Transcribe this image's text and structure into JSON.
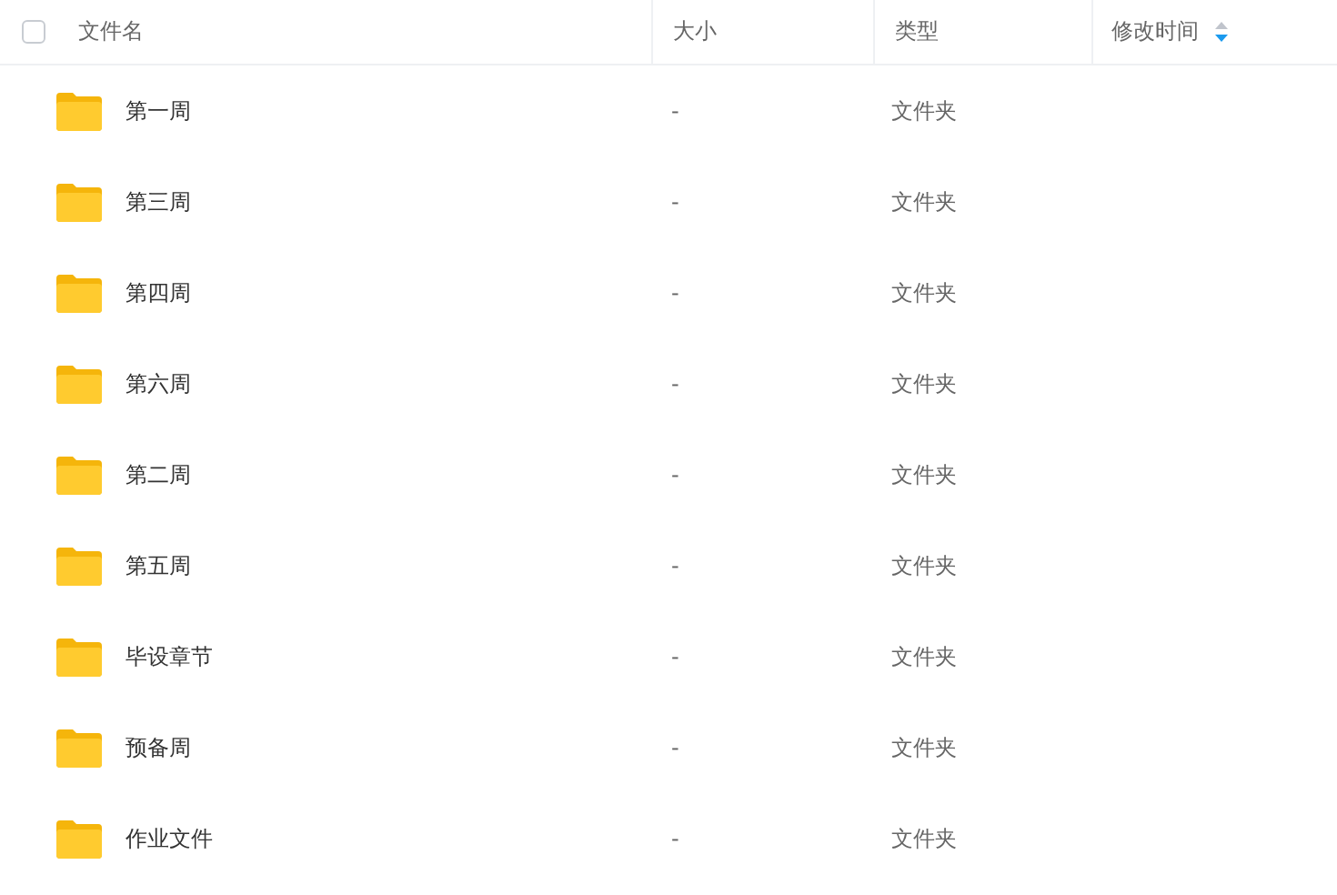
{
  "table": {
    "select_all": {
      "checked": false
    },
    "columns": [
      {
        "label": "文件名"
      },
      {
        "label": "大小"
      },
      {
        "label": "类型"
      },
      {
        "label": "修改时间",
        "sorted_descending": true
      }
    ],
    "rows": [
      {
        "name": "第一周",
        "size": "-",
        "type": "文件夹"
      },
      {
        "name": "第三周",
        "size": "-",
        "type": "文件夹"
      },
      {
        "name": "第四周",
        "size": "-",
        "type": "文件夹"
      },
      {
        "name": "第六周",
        "size": "-",
        "type": "文件夹"
      },
      {
        "name": "第二周",
        "size": "-",
        "type": "文件夹"
      },
      {
        "name": "第五周",
        "size": "-",
        "type": "文件夹"
      },
      {
        "name": "毕设章节",
        "size": "-",
        "type": "文件夹"
      },
      {
        "name": "预备周",
        "size": "-",
        "type": "文件夹"
      },
      {
        "name": "作业文件",
        "size": "-",
        "type": "文件夹"
      }
    ]
  }
}
